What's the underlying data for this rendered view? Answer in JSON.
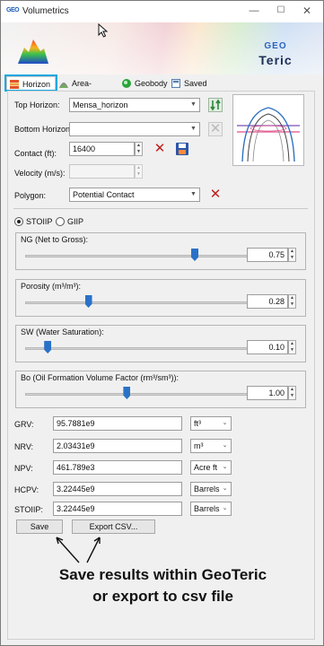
{
  "window": {
    "app_icon_text": "GEO",
    "title": "Volumetrics",
    "minimize": "—",
    "maximize": "☐",
    "close": "✕"
  },
  "brand": {
    "geo": "GEO",
    "name": "Teric"
  },
  "tabs": [
    {
      "label": "Horizon",
      "selected": true
    },
    {
      "label": "Area-Volume",
      "selected": false
    },
    {
      "label": "Geobody",
      "selected": false
    },
    {
      "label": "Saved results",
      "selected": false
    }
  ],
  "horizon": {
    "top_horizon_label": "Top Horizon:",
    "top_horizon_value": "Mensa_horizon",
    "bottom_horizon_label": "Bottom Horizon:",
    "bottom_horizon_value": "",
    "contact_label": "Contact (ft):",
    "contact_value": "16400",
    "velocity_label": "Velocity (m/s):",
    "velocity_value": "",
    "polygon_label": "Polygon:",
    "polygon_value": "Potential Contact"
  },
  "mode": {
    "stoiip_label": "STOIIP",
    "giip_label": "GIIP",
    "selected": "STOIIP"
  },
  "params": [
    {
      "title": "NG (Net to Gross):",
      "value": "0.75",
      "level": 0.75
    },
    {
      "title": "Porosity (m³/m³):",
      "value": "0.28",
      "level": 0.28
    },
    {
      "title": "SW (Water Saturation):",
      "value": "0.10",
      "level": 0.1
    },
    {
      "title": "Bo (Oil Formation Volume Factor (rm³/sm³)):",
      "value": "1.00",
      "level": 0.45
    }
  ],
  "results": [
    {
      "label": "GRV:",
      "value": "95.7881e9",
      "unit": "ft³"
    },
    {
      "label": "NRV:",
      "value": "2.03431e9",
      "unit": "m³"
    },
    {
      "label": "NPV:",
      "value": "461.789e3",
      "unit": "Acre ft"
    },
    {
      "label": "HCPV:",
      "value": "3.22445e9",
      "unit": "Barrels"
    },
    {
      "label": "STOIIP:",
      "value": "3.22445e9",
      "unit": "Barrels"
    }
  ],
  "buttons": {
    "save": "Save",
    "export": "Export CSV..."
  },
  "annotation": {
    "line1": "Save results within GeoTeric",
    "line2": "or export to csv file"
  },
  "colors": {
    "accent": "#2a72c8",
    "delete_red": "#c0201e",
    "tab_highlight": "#1aa7e0"
  }
}
